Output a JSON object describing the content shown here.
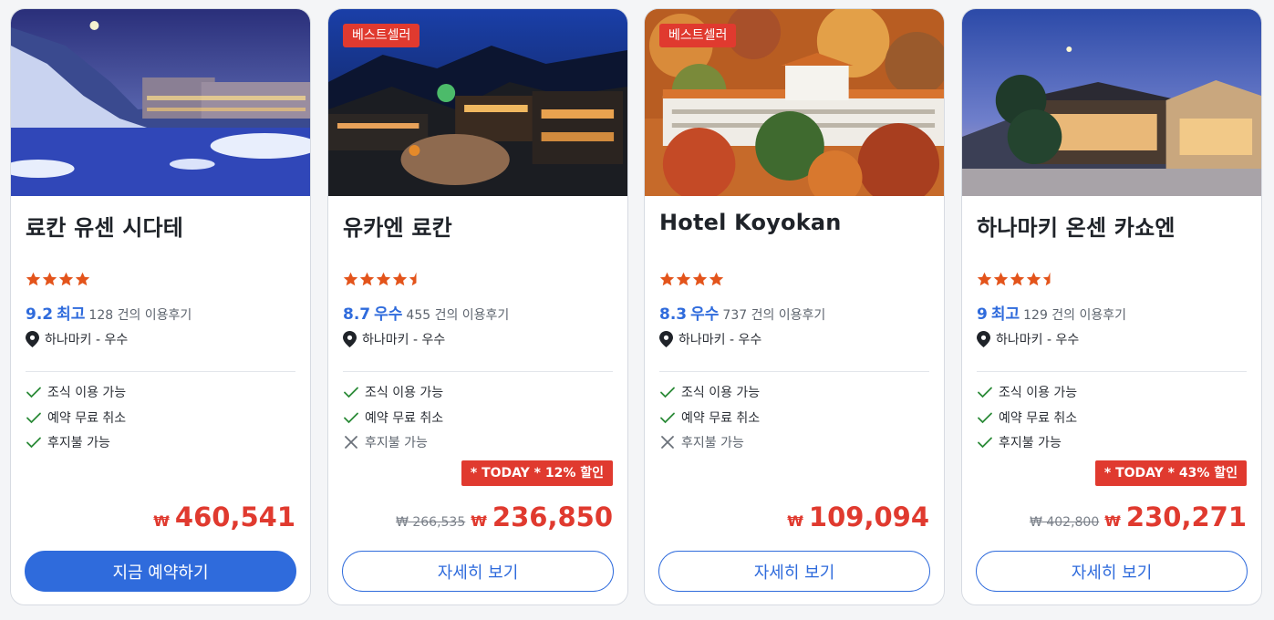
{
  "colors": {
    "accent": "#2f6bdc",
    "sale": "#e03a2f",
    "star": "#e3541b",
    "check": "#2a8a37"
  },
  "cards": [
    {
      "badge": "",
      "name": "료칸 유센 시다테",
      "stars": 4,
      "score": "9.2",
      "score_word": "최고",
      "reviews": "128 건의 이용후기",
      "location": "하나마키 - 우수",
      "features": [
        {
          "label": "조식 이용 가능",
          "available": true
        },
        {
          "label": "예약 무료 취소",
          "available": true
        },
        {
          "label": "후지불 가능",
          "available": true
        }
      ],
      "promo": "",
      "old_price": "",
      "currency": "₩",
      "price": "460,541",
      "button": "지금 예약하기",
      "button_style": "primary"
    },
    {
      "badge": "베스트셀러",
      "name": "유카엔 료칸",
      "stars": 4.5,
      "score": "8.7",
      "score_word": "우수",
      "reviews": "455 건의 이용후기",
      "location": "하나마키 - 우수",
      "features": [
        {
          "label": "조식 이용 가능",
          "available": true
        },
        {
          "label": "예약 무료 취소",
          "available": true
        },
        {
          "label": "후지불 가능",
          "available": false
        }
      ],
      "promo": "* TODAY * 12% 할인",
      "old_price": "₩ 266,535",
      "currency": "₩",
      "price": "236,850",
      "button": "자세히 보기",
      "button_style": "outline"
    },
    {
      "badge": "베스트셀러",
      "name": "Hotel Koyokan",
      "stars": 4,
      "score": "8.3",
      "score_word": "우수",
      "reviews": "737 건의 이용후기",
      "location": "하나마키 - 우수",
      "features": [
        {
          "label": "조식 이용 가능",
          "available": true
        },
        {
          "label": "예약 무료 취소",
          "available": true
        },
        {
          "label": "후지불 가능",
          "available": false
        }
      ],
      "promo": "",
      "old_price": "",
      "currency": "₩",
      "price": "109,094",
      "button": "자세히 보기",
      "button_style": "outline"
    },
    {
      "badge": "",
      "name": "하나마키 온센 카쇼엔",
      "stars": 4.5,
      "score": "9",
      "score_word": "최고",
      "reviews": "129 건의 이용후기",
      "location": "하나마키 - 우수",
      "features": [
        {
          "label": "조식 이용 가능",
          "available": true
        },
        {
          "label": "예약 무료 취소",
          "available": true
        },
        {
          "label": "후지불 가능",
          "available": true
        }
      ],
      "promo": "* TODAY * 43% 할인",
      "old_price": "₩ 402,800",
      "currency": "₩",
      "price": "230,271",
      "button": "자세히 보기",
      "button_style": "outline"
    }
  ]
}
